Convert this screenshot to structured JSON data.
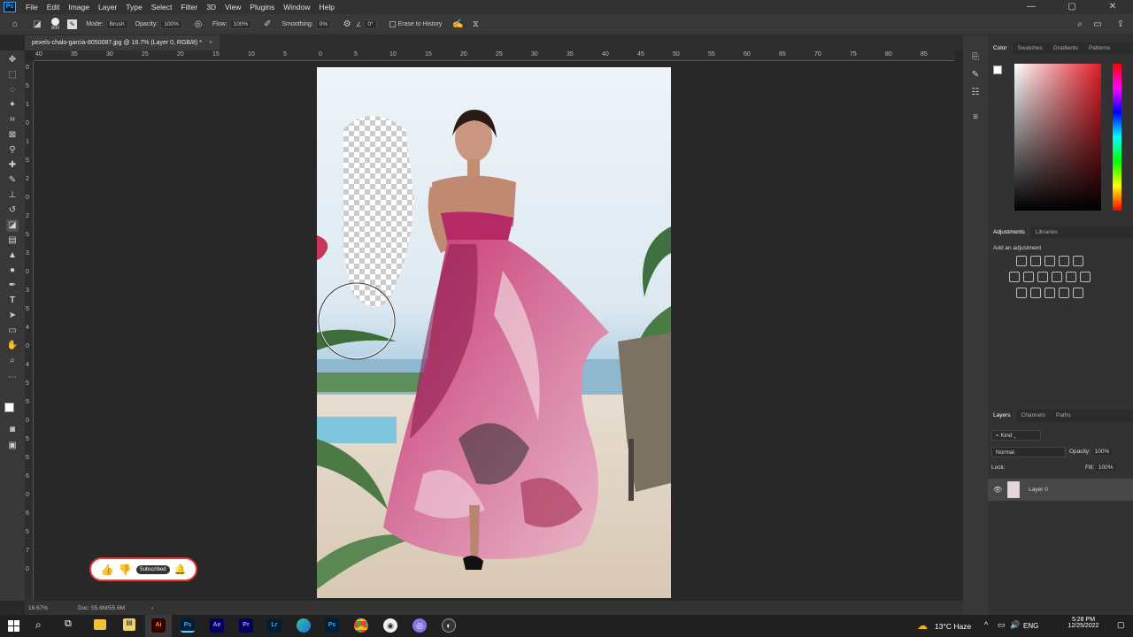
{
  "menubar": {
    "app_logo": "Ps",
    "items": [
      "File",
      "Edit",
      "Image",
      "Layer",
      "Type",
      "Select",
      "Filter",
      "3D",
      "View",
      "Plugins",
      "Window",
      "Help"
    ]
  },
  "options": {
    "brush_size": "800",
    "mode_label": "Mode:",
    "mode_value": "Brush",
    "opacity_label": "Opacity:",
    "opacity_value": "100%",
    "flow_label": "Flow:",
    "flow_value": "100%",
    "smoothing_label": "Smoothing:",
    "smoothing_value": "0%",
    "angle_value": "0°",
    "erase_history_label": "Erase to History"
  },
  "document": {
    "tab_title": "pexels-chalo-garcia-8050087.jpg @ 16.7% (Layer 0, RGB/8) *",
    "close": "×"
  },
  "ruler": {
    "top_labels": [
      "40",
      "35",
      "30",
      "25",
      "20",
      "15",
      "10",
      "5",
      "0",
      "5",
      "10",
      "15",
      "20",
      "25",
      "30",
      "35",
      "40",
      "45",
      "50",
      "55",
      "60",
      "65",
      "70",
      "75",
      "80",
      "85"
    ],
    "left_labels": [
      "0",
      "5",
      "1",
      "0",
      "1",
      "5",
      "2",
      "0",
      "2",
      "5",
      "3",
      "0",
      "3",
      "5",
      "4",
      "0",
      "4",
      "5",
      "5",
      "0",
      "5",
      "5",
      "6",
      "0",
      "6",
      "5",
      "7",
      "0"
    ]
  },
  "status": {
    "zoom": "16.67%",
    "doc": "Doc: 55.6M/55.6M"
  },
  "overlay": {
    "subscribed_label": "Subscribed"
  },
  "color_panel": {
    "tabs": [
      "Color",
      "Swatches",
      "Gradients",
      "Patterns"
    ]
  },
  "adjustments_panel": {
    "tabs": [
      "Adjustments",
      "Libraries"
    ],
    "add_label": "Add an adjustment"
  },
  "layers_panel": {
    "tabs": [
      "Layers",
      "Channels",
      "Paths"
    ],
    "kind_label": "Kind",
    "blend_mode": "Normal",
    "opacity_label": "Opacity:",
    "opacity_value": "100%",
    "lock_label": "Lock:",
    "fill_label": "Fill:",
    "fill_value": "100%",
    "layer_name": "Layer 0"
  },
  "taskbar": {
    "weather": "13°C Haze",
    "lang": "ENG",
    "time": "5:28 PM",
    "date": "12/25/2022",
    "apps": [
      {
        "label": "Ai",
        "color": "#ff9a00",
        "bg": "#330000"
      },
      {
        "label": "Ps",
        "color": "#31a8ff",
        "bg": "#001e36"
      },
      {
        "label": "Ae",
        "color": "#9999ff",
        "bg": "#00005b"
      },
      {
        "label": "Pr",
        "color": "#9999ff",
        "bg": "#00005b"
      },
      {
        "label": "Lr",
        "color": "#31a8ff",
        "bg": "#001e36"
      },
      {
        "label": "Ps",
        "color": "#31a8ff",
        "bg": "#001e36"
      }
    ]
  }
}
